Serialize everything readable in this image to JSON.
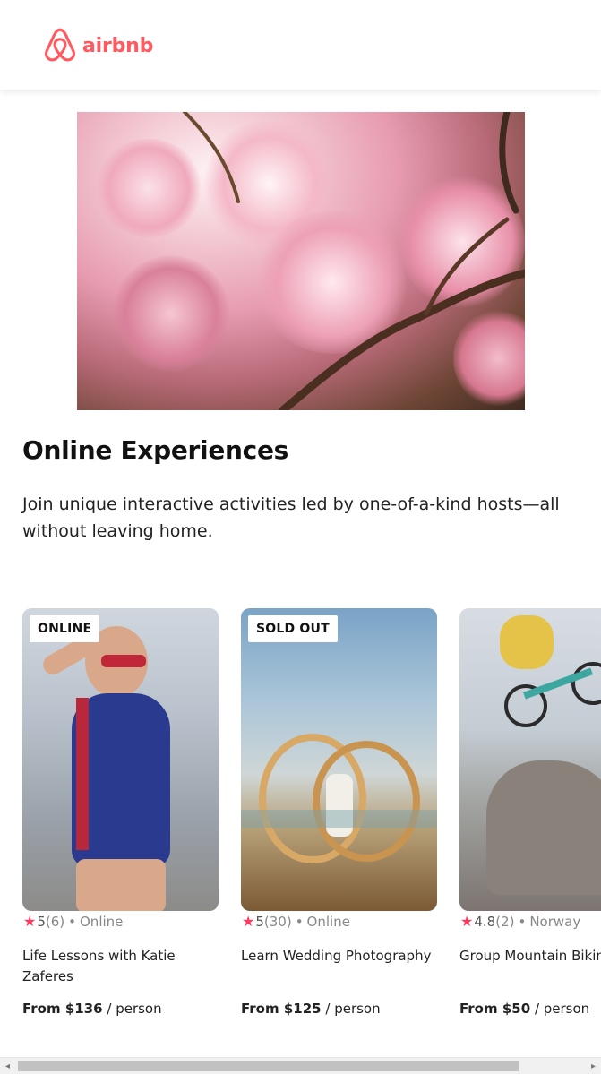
{
  "brand": {
    "name": "airbnb",
    "color": "#FF5A5F"
  },
  "hero": {
    "image": "cherry-blossom-photo"
  },
  "main": {
    "title": "Online Experiences",
    "subtitle": "Join unique interactive activities led by one-of-a-kind hosts—all without leaving home."
  },
  "cards": [
    {
      "badge": "ONLINE",
      "image": "triathlete-photo",
      "rating": "5",
      "reviews": "(6)",
      "location": "Online",
      "title": "Life Lessons with Katie Zaferes",
      "price": "From $136",
      "unit": "/ person"
    },
    {
      "badge": "SOLD OUT",
      "image": "wedding-rings-photo",
      "rating": "5",
      "reviews": "(30)",
      "location": "Online",
      "title": "Learn Wedding Photography",
      "price": "From $125",
      "unit": "/ person"
    },
    {
      "badge": "",
      "image": "mountain-biker-photo",
      "rating": "4.8",
      "reviews": "(2)",
      "location": "Norway",
      "title": "Group Mountain Biking",
      "price": "From $50",
      "unit": "/ person"
    }
  ],
  "star_color": "#FF385C",
  "separator": "•",
  "scrollbar": {
    "left_arrow": "◂",
    "right_arrow": "▸"
  }
}
